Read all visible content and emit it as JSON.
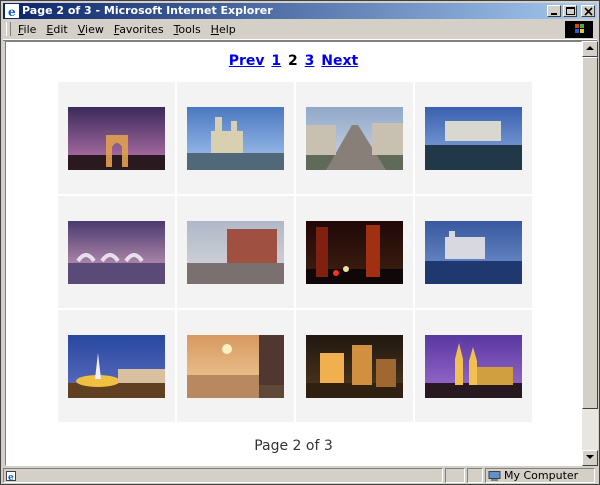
{
  "window": {
    "title": "Page 2 of 3 - Microsoft Internet Explorer"
  },
  "menu": [
    {
      "label": "File",
      "u": "F",
      "rest": "ile"
    },
    {
      "label": "Edit",
      "u": "E",
      "rest": "dit"
    },
    {
      "label": "View",
      "u": "V",
      "rest": "iew"
    },
    {
      "label": "Favorites",
      "u": "F",
      "rest": "avorites",
      "pre": ""
    },
    {
      "label": "Tools",
      "u": "T",
      "rest": "ools"
    },
    {
      "label": "Help",
      "u": "H",
      "rest": "elp"
    }
  ],
  "pager": {
    "prev": "Prev",
    "page1": "1",
    "current": "2",
    "page3": "3",
    "next": "Next"
  },
  "footer": "Page 2 of 3",
  "status": {
    "zone": "My Computer"
  },
  "thumbnails": [
    {
      "name": "thumb-arc-de-triomphe",
      "sky": "#3a2a5a",
      "sky2": "#c07ab0",
      "ground": "#2a1a20",
      "accent": "#e0a050",
      "subject": "arch"
    },
    {
      "name": "thumb-notre-dame",
      "sky": "#4a78c0",
      "sky2": "#a8c8f0",
      "ground": "#5a5a50",
      "accent": "#d8d0b0",
      "subject": "cathedral"
    },
    {
      "name": "thumb-champs-elysees",
      "sky": "#90a8c8",
      "sky2": "#d0dae8",
      "ground": "#606a58",
      "accent": "#c8c0b0",
      "subject": "avenue"
    },
    {
      "name": "thumb-palace-garden",
      "sky": "#3a60b0",
      "sky2": "#90b0e0",
      "ground": "#30502a",
      "accent": "#d8d8d0",
      "subject": "palace"
    },
    {
      "name": "thumb-thames-barrier",
      "sky": "#4a3a70",
      "sky2": "#d8a8c0",
      "ground": "#6a5a80",
      "accent": "#e8e0f0",
      "subject": "barrier"
    },
    {
      "name": "thumb-canal-buildings",
      "sky": "#b0b8c8",
      "sky2": "#d8d8d8",
      "ground": "#705848",
      "accent": "#a05040",
      "subject": "canal"
    },
    {
      "name": "thumb-night-street",
      "sky": "#200808",
      "sky2": "#402010",
      "ground": "#100808",
      "accent": "#e04020",
      "subject": "street"
    },
    {
      "name": "thumb-tower-of-london",
      "sky": "#3858a0",
      "sky2": "#7898d0",
      "ground": "#203060",
      "accent": "#e0e0f0",
      "subject": "tower"
    },
    {
      "name": "thumb-trafalgar-fountain",
      "sky": "#2848a0",
      "sky2": "#6070c0",
      "ground": "#604020",
      "accent": "#f0c040",
      "subject": "fountain"
    },
    {
      "name": "thumb-river-sunset",
      "sky": "#d89860",
      "sky2": "#f0d0a0",
      "ground": "#604838",
      "accent": "#fff0c0",
      "subject": "river"
    },
    {
      "name": "thumb-city-night-aerial",
      "sky": "#201810",
      "sky2": "#503820",
      "ground": "#302010",
      "accent": "#f0b050",
      "subject": "city"
    },
    {
      "name": "thumb-gothic-cathedral",
      "sky": "#5838a0",
      "sky2": "#a070d0",
      "ground": "#281820",
      "accent": "#f0c050",
      "subject": "gothic"
    }
  ]
}
